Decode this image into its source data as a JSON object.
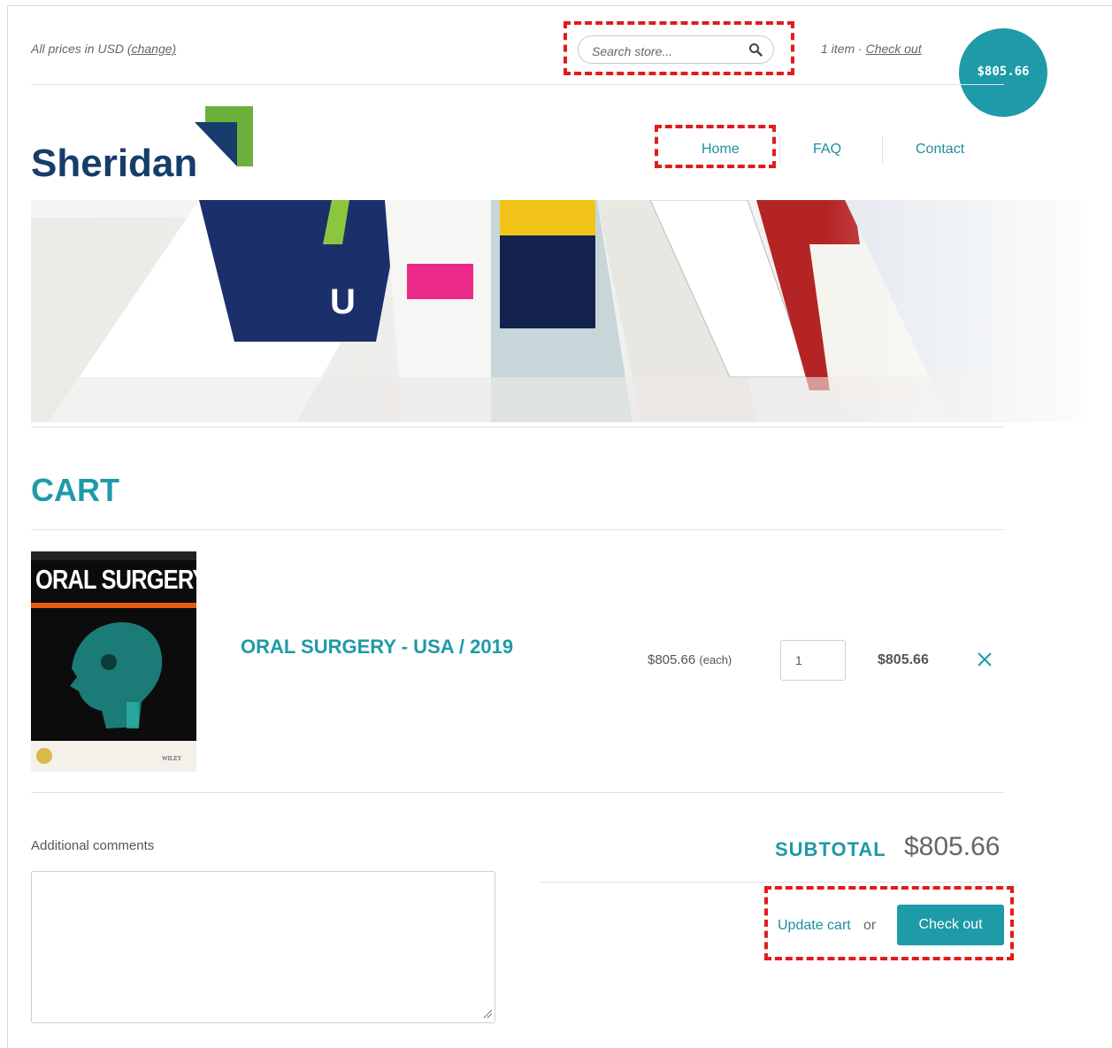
{
  "topbar": {
    "currency_text": "All prices in USD",
    "currency_change": "(change)",
    "search_placeholder": "Search store...",
    "cart_count": "1 item",
    "cart_separator": "·",
    "cart_checkout": "Check out",
    "cart_total": "$805.66"
  },
  "brand": {
    "name": "Sheridan"
  },
  "nav": {
    "items": [
      {
        "label": "Home"
      },
      {
        "label": "FAQ"
      },
      {
        "label": "Contact"
      }
    ]
  },
  "cart": {
    "title": "CART",
    "items": [
      {
        "cover_title": "ORAL SURGERY",
        "cover_publisher": "WILEY",
        "name": "ORAL SURGERY - USA / 2019",
        "unit_price": "$805.66",
        "unit_note": "(each)",
        "quantity": "1",
        "line_total": "$805.66"
      }
    ],
    "comments_label": "Additional comments",
    "subtotal_label": "SUBTOTAL",
    "subtotal_value": "$805.66",
    "update_label": "Update cart",
    "or_label": "or",
    "checkout_label": "Check out"
  },
  "colors": {
    "accent": "#1e9aa8",
    "brand_blue": "#163d6b",
    "brand_green": "#6bb13b",
    "highlight": "#e21b1b"
  },
  "icons": {
    "search": "search-icon",
    "remove": "close-icon"
  }
}
